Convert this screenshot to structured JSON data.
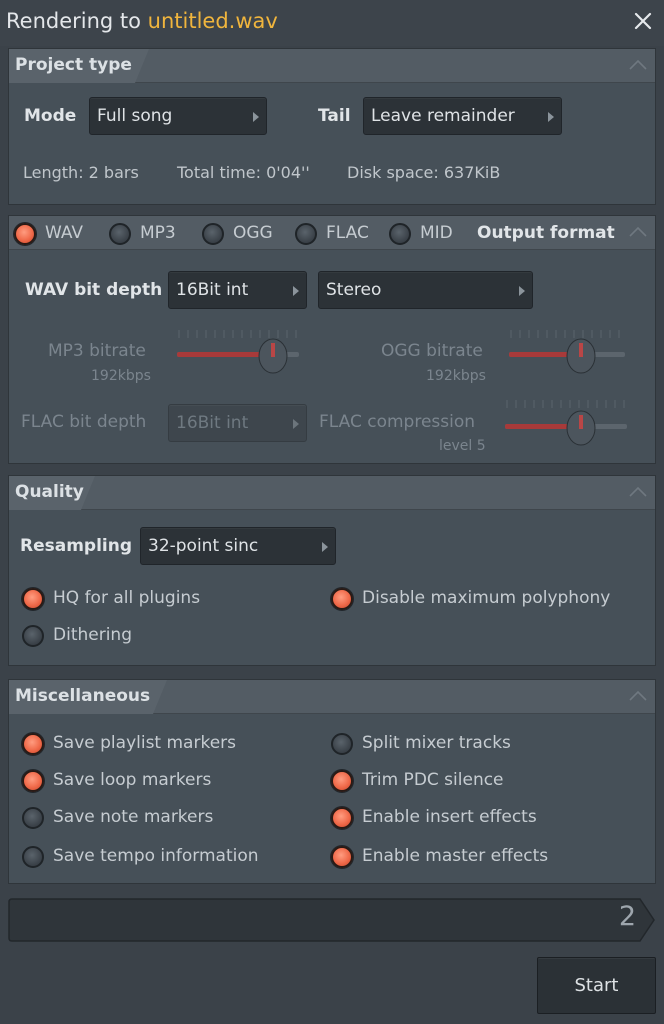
{
  "window": {
    "title_prefix": "Rendering to ",
    "title_file": "untitled.wav"
  },
  "project_type": {
    "title": "Project type",
    "mode_label": "Mode",
    "mode_value": "Full song",
    "tail_label": "Tail",
    "tail_value": "Leave remainder",
    "length": "Length: 2 bars",
    "total_time": "Total time: 0'04''",
    "disk_space": "Disk space: 637KiB"
  },
  "output_format": {
    "title": "Output format",
    "formats": [
      {
        "label": "WAV",
        "selected": true
      },
      {
        "label": "MP3",
        "selected": false
      },
      {
        "label": "OGG",
        "selected": false
      },
      {
        "label": "FLAC",
        "selected": false
      },
      {
        "label": "MID",
        "selected": false
      }
    ],
    "wav_bit_depth_label": "WAV bit depth",
    "wav_bit_depth_value": "16Bit int",
    "channels_value": "Stereo",
    "mp3_bitrate_label": "MP3 bitrate",
    "mp3_bitrate_value": "192kbps",
    "ogg_bitrate_label": "OGG bitrate",
    "ogg_bitrate_value": "192kbps",
    "flac_bit_depth_label": "FLAC bit depth",
    "flac_bit_depth_value": "16Bit int",
    "flac_compression_label": "FLAC compression",
    "flac_compression_value": "level 5"
  },
  "quality": {
    "title": "Quality",
    "resampling_label": "Resampling",
    "resampling_value": "32-point sinc",
    "options": [
      {
        "label": "HQ for all plugins",
        "checked": true
      },
      {
        "label": "Disable maximum polyphony",
        "checked": true
      },
      {
        "label": "Dithering",
        "checked": false
      }
    ]
  },
  "misc": {
    "title": "Miscellaneous",
    "options": [
      {
        "label": "Save playlist markers",
        "checked": true
      },
      {
        "label": "Split mixer tracks",
        "checked": false
      },
      {
        "label": "Save loop markers",
        "checked": true
      },
      {
        "label": "Trim PDC silence",
        "checked": true
      },
      {
        "label": "Save note markers",
        "checked": false
      },
      {
        "label": "Enable insert effects",
        "checked": true
      },
      {
        "label": "Save tempo information",
        "checked": false
      },
      {
        "label": "Enable master effects",
        "checked": true
      }
    ]
  },
  "progress": {
    "value_text": "2"
  },
  "actions": {
    "start_label": "Start"
  },
  "colors": {
    "accent_orange": "#f06a4a",
    "title_file": "#f0b53d",
    "background": "#3b4249"
  }
}
